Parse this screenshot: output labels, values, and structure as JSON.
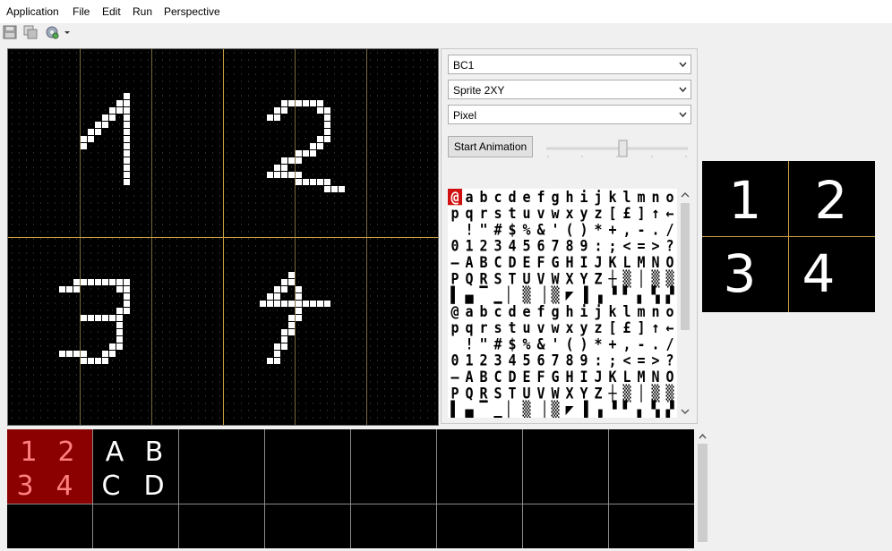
{
  "menu": {
    "items": [
      "Application",
      "File",
      "Edit",
      "Run",
      "Perspective"
    ]
  },
  "toolbar": {
    "icons": [
      "save-icon",
      "copy-icon",
      "run-settings-icon",
      "dropdown-arrow-icon"
    ]
  },
  "editor": {
    "grid_color": "#c8a040",
    "pixel_color": "#ffffff"
  },
  "controls": {
    "charset_select": "BC1",
    "mode_select": "Sprite 2XY",
    "draw_select": "Pixel",
    "start_button": "Start Animation"
  },
  "charset_rows": [
    "@abcdefghijklmno",
    "pqrstuvwxyz[£]↑←",
    " !\"#$%&'()*+,-./",
    "0123456789:;<=>?",
    "—ABCDEFGHIJKLMNO",
    "PQRSTUVWXYZ┼▒│▒▒",
    "▌▄▔▁▏▒▕▒◤▐▗▝▘▖▚▞",
    "@abcdefghijklmno",
    "pqrstuvwxyz[£]↑←",
    " !\"#$%&'()*+,-./",
    "0123456789:;<=>?",
    "—ABCDEFGHIJKLMNO",
    "PQRSTUVWXYZ┼▒│▒▒",
    "▌▄▔▁▏▒▕▒◤▐▗▝▘▖▚▞"
  ],
  "preview": {
    "glyphs": [
      "1",
      "2",
      "3",
      "4"
    ]
  },
  "bottom": {
    "cells": [
      {
        "glyphs": [
          "1",
          "2",
          "3",
          "4"
        ],
        "selected": true
      },
      {
        "glyphs": [
          "A",
          "B",
          "C",
          "D"
        ],
        "selected": false
      }
    ],
    "selected_color": "#8b0000",
    "selected_text_color": "#ff8080"
  }
}
